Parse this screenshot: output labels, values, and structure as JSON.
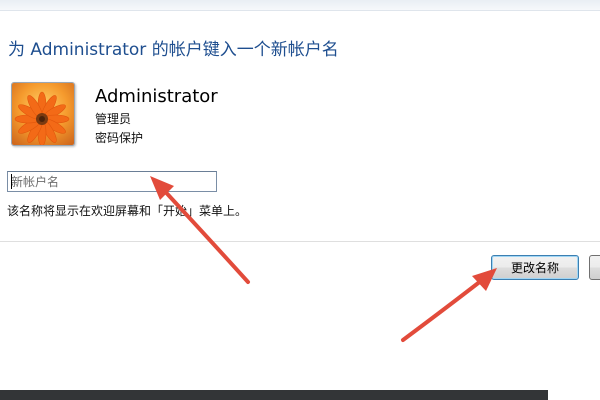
{
  "dialog": {
    "title": "为 Administrator 的帐户键入一个新帐户名",
    "account": {
      "name": "Administrator",
      "role": "管理员",
      "password_status": "密码保护",
      "picture_icon": "flower-account-picture"
    },
    "new_name_input": {
      "value": "",
      "placeholder": "新帐户名"
    },
    "hint": "该名称将显示在欢迎屏幕和「开始」菜单上。",
    "buttons": {
      "change_name": "更改名称",
      "cancel": ""
    }
  },
  "colors": {
    "title": "#1e4e8f",
    "annotation_arrow": "#e24b3b"
  }
}
